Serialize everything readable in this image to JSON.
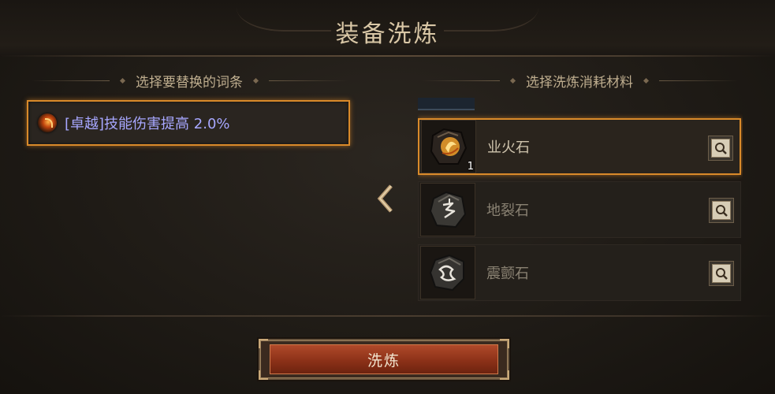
{
  "window": {
    "title": "装备洗炼"
  },
  "left_panel": {
    "header": "选择要替换的词条",
    "affix": {
      "text": "[卓越]技能伤害提高 2.0%",
      "icon": "flame-orb-icon",
      "color": "#a7a7ff",
      "selected": true
    }
  },
  "right_panel": {
    "header": "选择洗炼消耗材料",
    "materials": [
      {
        "name": "业火石",
        "count": "1",
        "icon": "hellfire-stone-icon",
        "selected": true
      },
      {
        "name": "地裂石",
        "count": "",
        "icon": "earth-rift-stone-icon",
        "selected": false
      },
      {
        "name": "震颤石",
        "count": "",
        "icon": "tremor-stone-icon",
        "selected": false
      }
    ]
  },
  "actions": {
    "refine_label": "洗炼"
  },
  "colors": {
    "accent": "#d98a2a",
    "button": "#8c3118"
  }
}
